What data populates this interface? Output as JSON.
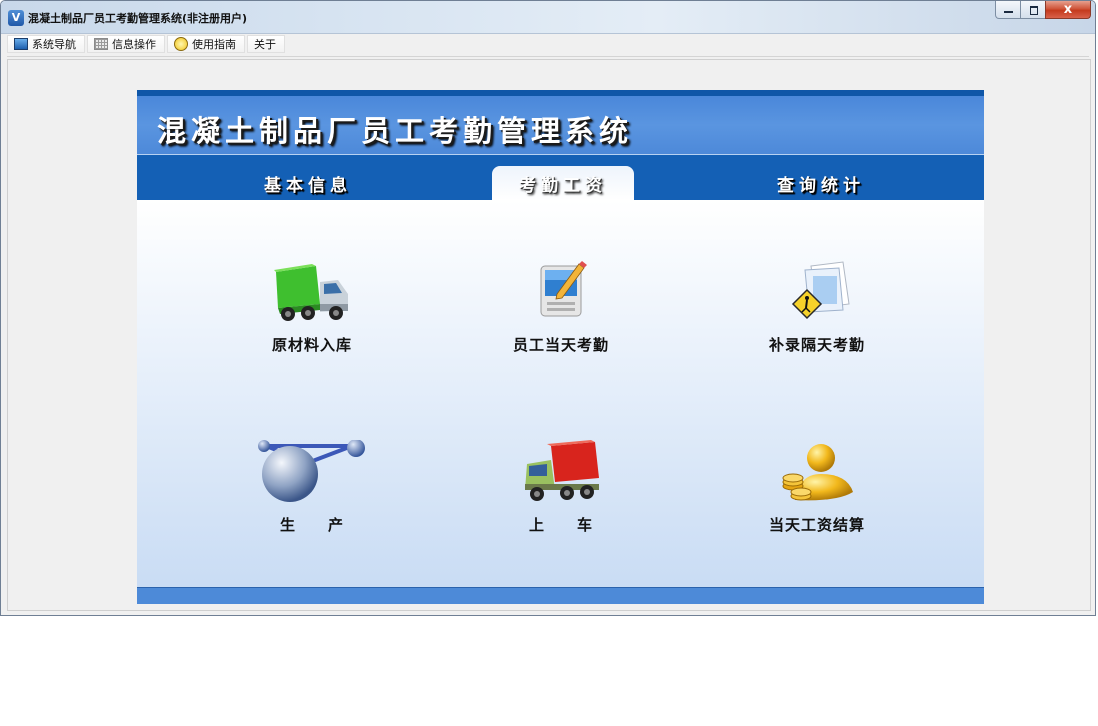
{
  "window": {
    "title": "混凝土制品厂员工考勤管理系统(非注册用户)",
    "app_icon_glyph": "V",
    "close_glyph": "x"
  },
  "menu": [
    {
      "label": "系统导航",
      "icon": "monitor-icon"
    },
    {
      "label": "信息操作",
      "icon": "grid-icon"
    },
    {
      "label": "使用指南",
      "icon": "clock-icon"
    },
    {
      "label": "关于",
      "icon": ""
    }
  ],
  "banner": {
    "title": "混凝土制品厂员工考勤管理系统"
  },
  "tabs": [
    {
      "label": "基本信息",
      "active": false
    },
    {
      "label": "考勤工资",
      "active": true
    },
    {
      "label": "查询统计",
      "active": false
    }
  ],
  "items": [
    {
      "label": "原材料入库",
      "icon": "green-truck-icon"
    },
    {
      "label": "员工当天考勤",
      "icon": "computer-pencil-icon"
    },
    {
      "label": "补录隔天考勤",
      "icon": "documents-warning-icon"
    },
    {
      "label": "生　　产",
      "icon": "molecule-sphere-icon"
    },
    {
      "label": "上　　车",
      "icon": "red-truck-icon"
    },
    {
      "label": "当天工资结算",
      "icon": "gold-person-coins-icon"
    }
  ],
  "colors": {
    "banner_blue": "#4a87da",
    "tab_bar_blue": "#1460b5",
    "panel_gradient_bottom": "#c9dcf4"
  }
}
